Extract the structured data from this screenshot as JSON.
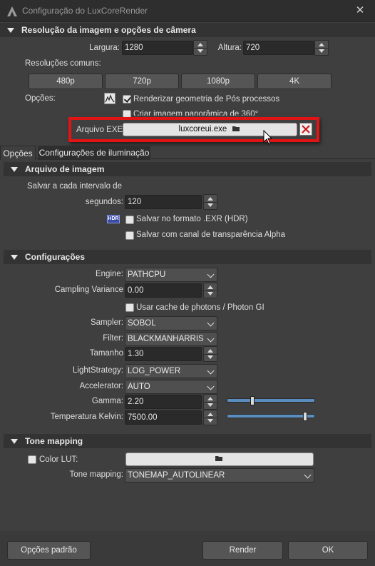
{
  "window": {
    "title": "Configuração do LuxCoreRender",
    "close_label": "✕"
  },
  "resolution_section": {
    "title": "Resolução da imagem e opções de câmera",
    "width_label": "Largura:",
    "width_value": "1280",
    "height_label": "Altura:",
    "height_value": "720",
    "common_label": "Resoluções comuns:",
    "presets": [
      "480p",
      "720p",
      "1080p",
      "4K"
    ],
    "options_label": "Opções:",
    "opt_postpro": "Renderizar geometria de Pós processos",
    "opt_panoramic": "Criar imagem panorâmica de 360°",
    "exe_label": "Arquivo EXE:",
    "exe_value": "luxcoreui.exe"
  },
  "tabs": [
    "Opções",
    "Configurações de iluminação"
  ],
  "image_file_section": {
    "title": "Arquivo de imagem",
    "interval_label_1": "Salvar a cada intervalo de",
    "interval_label_2": "segundos:",
    "interval_value": "120",
    "hdr_badge": "HDR",
    "save_exr": "Salvar no formato .EXR (HDR)",
    "save_alpha": "Salvar com canal de transparência Alpha"
  },
  "config_section": {
    "title": "Configurações",
    "engine_label": "Engine:",
    "engine_value": "PATHCPU",
    "variance_label": "Campling Variance",
    "variance_value": "0.00",
    "photon_cache": "Usar cache de photons / Photon GI",
    "sampler_label": "Sampler:",
    "sampler_value": "SOBOL",
    "filter_label": "Filter:",
    "filter_value": "BLACKMANHARRIS",
    "size_label": "Tamanho",
    "size_value": "1.30",
    "light_label": "LightStrategy:",
    "light_value": "LOG_POWER",
    "accel_label": "Accelerator:",
    "accel_value": "AUTO",
    "gamma_label": "Gamma:",
    "gamma_value": "2.20",
    "kelvin_label": "Temperatura Kelvin:",
    "kelvin_value": "7500.00",
    "gamma_slider_fraction": 0.28,
    "kelvin_slider_fraction": 0.91
  },
  "tone_section": {
    "title": "Tone mapping",
    "color_lut": "Color LUT:",
    "tone_label": "Tone mapping:",
    "tone_value": "TONEMAP_AUTOLINEAR"
  },
  "footer": {
    "defaults": "Opções padrão",
    "render": "Render",
    "ok": "OK"
  },
  "colors": {
    "accent_red": "#e01414",
    "slider_blue": "#5a8ec0"
  }
}
